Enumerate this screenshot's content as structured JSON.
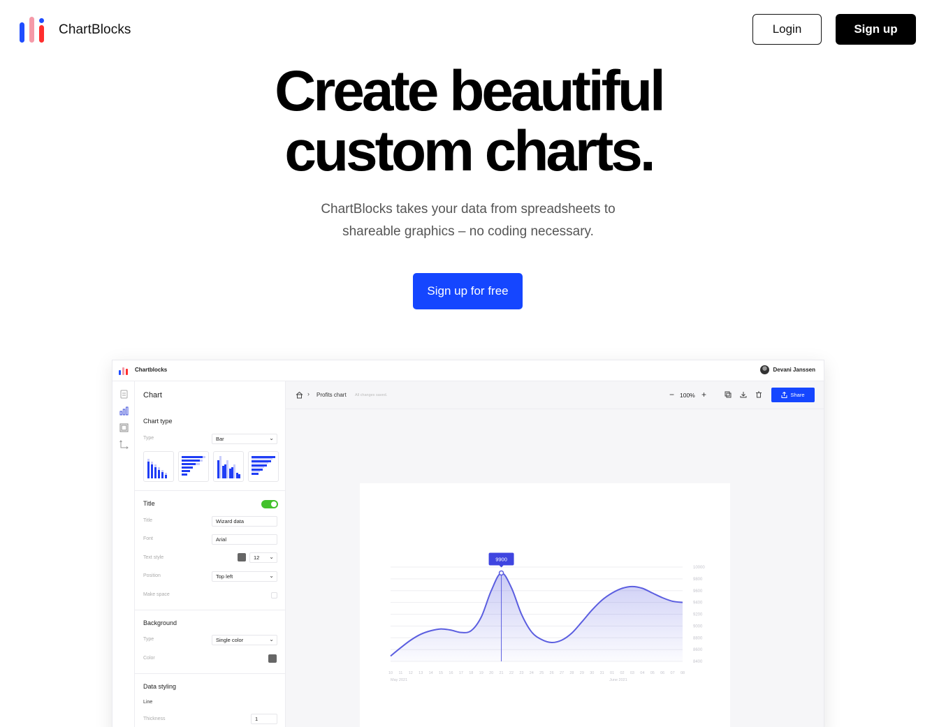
{
  "nav": {
    "brand": "ChartBlocks",
    "login_label": "Login",
    "signup_label": "Sign up"
  },
  "hero": {
    "title_line1": "Create beautiful",
    "title_line2": "custom charts.",
    "subtitle_line1": "ChartBlocks takes your data from spreadsheets to",
    "subtitle_line2": "shareable graphics – no coding necessary.",
    "cta_label": "Sign up for free"
  },
  "colors": {
    "accent": "#1546ff",
    "logo_blue": "#1f4dff",
    "logo_pink": "#f59aa8",
    "logo_red": "#ff2e2e",
    "toggle_on": "#43c12b",
    "line": "#5b5ee0"
  },
  "app": {
    "app_name": "Chartblocks",
    "user_name": "Devani Janssen",
    "rail_icons": [
      "document-icon",
      "bar-chart-icon",
      "frame-icon",
      "axes-icon"
    ],
    "panel": {
      "heading": "Chart",
      "chart_type": {
        "heading": "Chart type",
        "type_label": "Type",
        "type_value": "Bar",
        "thumbnails": [
          "vertical-bars-icon",
          "horizontal-bars-icon",
          "grouped-bars-icon",
          "stacked-bars-icon"
        ]
      },
      "title": {
        "heading": "Title",
        "enabled": true,
        "title_label": "Title",
        "title_value": "Wizard data",
        "font_label": "Font",
        "font_value": "Arial",
        "text_style_label": "Text style",
        "text_size": "12",
        "position_label": "Position",
        "position_value": "Top left",
        "make_space_label": "Make space"
      },
      "background": {
        "heading": "Background",
        "type_label": "Type",
        "type_value": "Single color",
        "color_label": "Color"
      },
      "data_styling": {
        "heading": "Data styling",
        "line_label": "Line",
        "thickness_label": "Thickness",
        "thickness_value": "1"
      }
    },
    "canvas": {
      "breadcrumb": "Profits chart",
      "saved_status": "All changes saved.",
      "zoom": "100%",
      "share_label": "Share"
    }
  },
  "chart_data": {
    "type": "area",
    "x": [
      "10",
      "11",
      "12",
      "13",
      "14",
      "15",
      "16",
      "17",
      "18",
      "19",
      "20",
      "21",
      "22",
      "23",
      "24",
      "25",
      "26",
      "27",
      "28",
      "29",
      "30",
      "31",
      "01",
      "02",
      "03",
      "04",
      "05",
      "06",
      "07",
      "08"
    ],
    "x_groups": [
      "May 2021",
      "June 2021"
    ],
    "values": [
      8490,
      8630,
      8760,
      8860,
      8920,
      8950,
      8930,
      8890,
      8920,
      9150,
      9600,
      9900,
      9650,
      9200,
      8900,
      8770,
      8720,
      8760,
      8880,
      9070,
      9270,
      9440,
      9560,
      9640,
      9670,
      9640,
      9560,
      9480,
      9420,
      9400
    ],
    "yticks": [
      "10000",
      "9800",
      "9600",
      "9400",
      "9200",
      "9000",
      "8800",
      "8600",
      "8400"
    ],
    "ylim": [
      8400,
      10000
    ],
    "tooltip": "9900",
    "highlight_x": "21",
    "grid": true
  }
}
